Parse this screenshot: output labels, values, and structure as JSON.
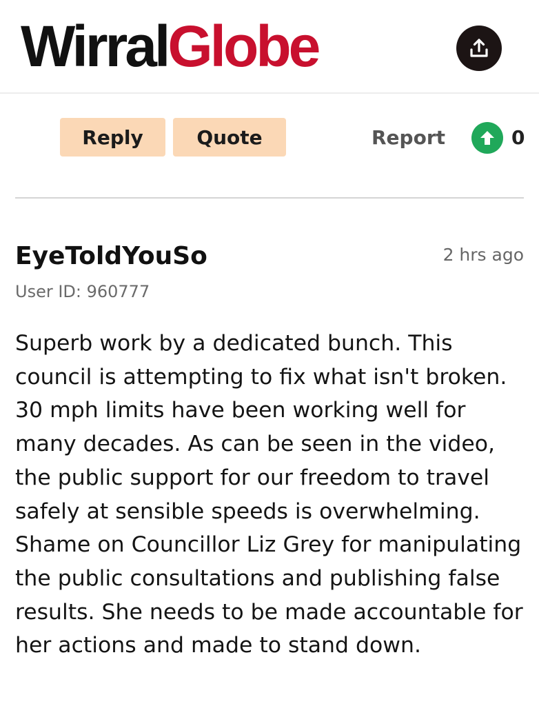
{
  "header": {
    "logo_part1": "Wirral",
    "logo_part2": "Globe",
    "share_icon": "upload-share-icon",
    "brand_color": "#c8102e"
  },
  "actions": {
    "reply_label": "Reply",
    "quote_label": "Quote",
    "report_label": "Report",
    "upvote_icon": "arrow-up-icon",
    "vote_count": "0",
    "upvote_color": "#20a85a",
    "button_color": "#fbd8b6"
  },
  "comment": {
    "username": "EyeToldYouSo",
    "timestamp": "2 hrs ago",
    "user_id": "User ID: 960777",
    "text": "Superb work by a dedicated bunch. This council is attempting to fix what isn't broken. 30 mph limits have been working well for many decades. As can be seen in the video, the public support for our freedom to travel safely at sensible speeds is overwhelming. Shame on Councillor Liz Grey for manipulating the public consultations and publishing false results. She needs to be made accountable for her actions and made to stand down."
  }
}
